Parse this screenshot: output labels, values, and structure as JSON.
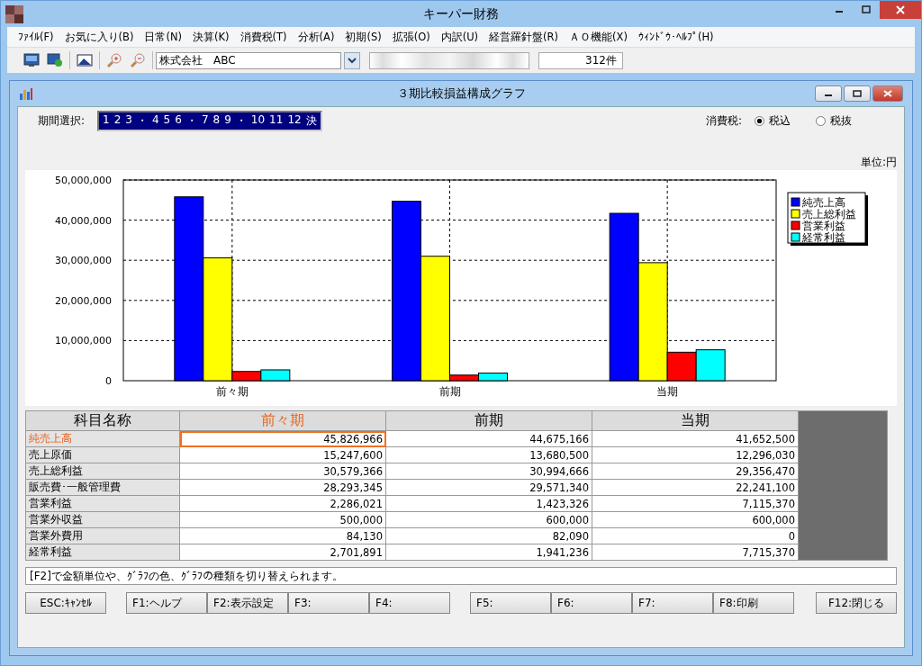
{
  "window": {
    "title": "キーパー財務"
  },
  "menu": [
    "ﾌｧｲﾙ(F)",
    "お気に入り(B)",
    "日常(N)",
    "決算(K)",
    "消費税(T)",
    "分析(A)",
    "初期(S)",
    "拡張(O)",
    "内訳(U)",
    "経営羅針盤(R)",
    "ＡＯ機能(X)",
    "ｳｨﾝﾄﾞｳ･ﾍﾙﾌﾟ(H)"
  ],
  "toolbar": {
    "company": "株式会社　ABC",
    "count": "312件"
  },
  "child_window": {
    "title": "３期比較損益構成グラフ"
  },
  "period": {
    "label": "期間選択:",
    "items": [
      "1",
      "2",
      "3",
      "・",
      "4",
      "5",
      "6",
      "・",
      "7",
      "8",
      "9",
      "・",
      "10",
      "11",
      "12",
      "決"
    ]
  },
  "tax": {
    "label": "消費税:",
    "options": [
      {
        "label": "税込",
        "selected": true
      },
      {
        "label": "税抜",
        "selected": false
      }
    ]
  },
  "unit": "単位:円",
  "chart_data": {
    "type": "bar",
    "categories": [
      "前々期",
      "前期",
      "当期"
    ],
    "series": [
      {
        "name": "純売上高",
        "color": "#0000ff",
        "values": [
          45800000,
          44700000,
          41700000
        ]
      },
      {
        "name": "売上総利益",
        "color": "#ffff00",
        "values": [
          30600000,
          31000000,
          29400000
        ]
      },
      {
        "name": "営業利益",
        "color": "#ff0000",
        "values": [
          2300000,
          1400000,
          7100000
        ]
      },
      {
        "name": "経常利益",
        "color": "#00ffff",
        "values": [
          2700000,
          1900000,
          7700000
        ]
      }
    ],
    "grid": true,
    "legend": true,
    "ylim": [
      0,
      50000000
    ],
    "yticks": [
      {
        "value": 0,
        "label": "0"
      },
      {
        "value": 10000000,
        "label": "10,000,000"
      },
      {
        "value": 20000000,
        "label": "20,000,000"
      },
      {
        "value": 30000000,
        "label": "30,000,000"
      },
      {
        "value": 40000000,
        "label": "40,000,000"
      },
      {
        "value": 50000000,
        "label": "50,000,000"
      }
    ]
  },
  "table": {
    "columns": [
      {
        "label": "科目名称",
        "selected": false
      },
      {
        "label": "前々期",
        "selected": true
      },
      {
        "label": "前期",
        "selected": false
      },
      {
        "label": "当期",
        "selected": false
      }
    ],
    "rows": [
      {
        "name": "純売上高",
        "selected": true,
        "values": [
          "45,826,966",
          "44,675,166",
          "41,652,500"
        ]
      },
      {
        "name": "売上原価",
        "selected": false,
        "values": [
          "15,247,600",
          "13,680,500",
          "12,296,030"
        ]
      },
      {
        "name": "売上総利益",
        "selected": false,
        "values": [
          "30,579,366",
          "30,994,666",
          "29,356,470"
        ]
      },
      {
        "name": "販売費･一般管理費",
        "selected": false,
        "values": [
          "28,293,345",
          "29,571,340",
          "22,241,100"
        ]
      },
      {
        "name": "営業利益",
        "selected": false,
        "values": [
          "2,286,021",
          "1,423,326",
          "7,115,370"
        ]
      },
      {
        "name": "営業外収益",
        "selected": false,
        "values": [
          "500,000",
          "600,000",
          "600,000"
        ]
      },
      {
        "name": "営業外費用",
        "selected": false,
        "values": [
          "84,130",
          "82,090",
          "0"
        ]
      },
      {
        "name": "経常利益",
        "selected": false,
        "values": [
          "2,701,891",
          "1,941,236",
          "7,715,370"
        ]
      }
    ]
  },
  "status_message": "[F2]で金額単位や、ｸﾞﾗﾌの色、ｸﾞﾗﾌの種類を切り替えられます。",
  "button_groups": [
    [
      "ESC:ｷｬﾝｾﾙ"
    ],
    [
      "F1:ヘルプ",
      "F2:表示設定",
      "F3:",
      "F4:"
    ],
    [
      "F5:",
      "F6:",
      "F7:",
      "F8:印刷"
    ],
    [
      "F12:閉じる"
    ]
  ]
}
